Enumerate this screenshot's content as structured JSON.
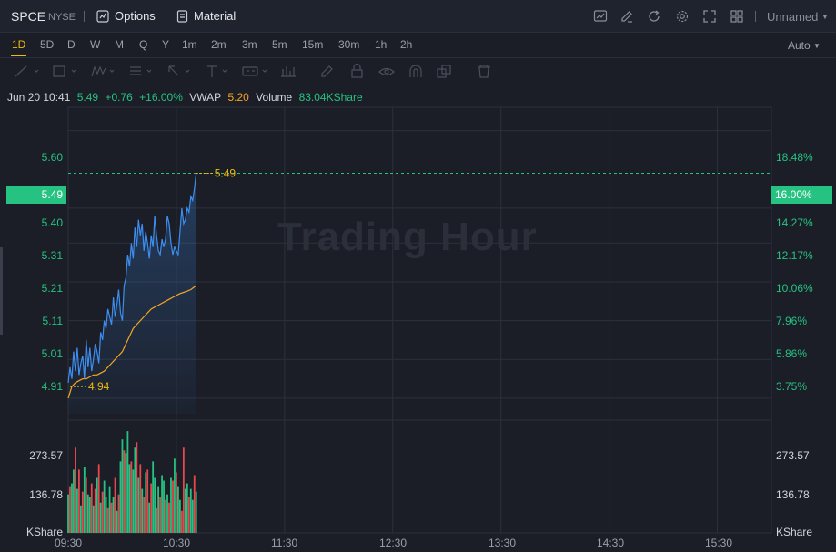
{
  "header": {
    "symbol": "SPCE",
    "exchange": "NYSE",
    "options_label": "Options",
    "material_label": "Material",
    "layout_name": "Unnamed"
  },
  "intervals": {
    "items": [
      "1D",
      "5D",
      "D",
      "W",
      "M",
      "Q",
      "Y",
      "1m",
      "2m",
      "3m",
      "5m",
      "15m",
      "30m",
      "1h",
      "2h"
    ],
    "active": "1D",
    "scale_label": "Auto"
  },
  "info": {
    "datetime": "Jun 20 10:41",
    "price": "5.49",
    "change": "+0.76",
    "change_pct": "+16.00%",
    "vwap_label": "VWAP",
    "vwap_value": "5.20",
    "volume_label": "Volume",
    "volume_value": "83.04KShare"
  },
  "price_axis": {
    "left_ticks": [
      "5.60",
      "5.40",
      "5.31",
      "5.21",
      "5.11",
      "5.01",
      "4.91"
    ],
    "right_ticks": [
      "18.48%",
      "14.27%",
      "12.17%",
      "10.06%",
      "7.96%",
      "5.86%",
      "3.75%"
    ],
    "current_left": "5.49",
    "current_right": "16.00%"
  },
  "volume_axis": {
    "ticks": [
      "273.57",
      "136.78"
    ],
    "unit": "KShare"
  },
  "time_axis": [
    "09:30",
    "10:30",
    "11:30",
    "12:30",
    "13:30",
    "14:30",
    "15:30"
  ],
  "watermark": "Trading Hour",
  "annotations": {
    "high_label": "5.49",
    "low_label": "4.94"
  },
  "colors": {
    "up": "#26c281",
    "down": "#e5484d",
    "price_line": "#3d8ef0",
    "vwap_line": "#f5a623",
    "accent": "#f0b90b"
  },
  "chart_data": {
    "type": "line",
    "x_range": [
      "09:30",
      "16:00"
    ],
    "ylim": [
      4.87,
      5.66
    ],
    "series": [
      {
        "name": "Price",
        "x": [
          "09:30",
          "09:31",
          "09:32",
          "09:33",
          "09:34",
          "09:35",
          "09:36",
          "09:37",
          "09:38",
          "09:39",
          "09:40",
          "09:41",
          "09:42",
          "09:43",
          "09:44",
          "09:45",
          "09:46",
          "09:47",
          "09:48",
          "09:49",
          "09:50",
          "09:51",
          "09:52",
          "09:53",
          "09:54",
          "09:55",
          "09:56",
          "09:57",
          "09:58",
          "09:59",
          "10:00",
          "10:01",
          "10:02",
          "10:03",
          "10:04",
          "10:05",
          "10:06",
          "10:07",
          "10:08",
          "10:09",
          "10:10",
          "10:11",
          "10:12",
          "10:13",
          "10:14",
          "10:15",
          "10:16",
          "10:17",
          "10:18",
          "10:19",
          "10:20",
          "10:21",
          "10:22",
          "10:23",
          "10:24",
          "10:25",
          "10:26",
          "10:27",
          "10:28",
          "10:29",
          "10:30",
          "10:31",
          "10:32",
          "10:33",
          "10:34",
          "10:35",
          "10:36",
          "10:37",
          "10:38",
          "10:39",
          "10:40",
          "10:41"
        ],
        "values": [
          4.95,
          4.99,
          4.96,
          5.03,
          4.98,
          5.04,
          4.97,
          5.0,
          5.02,
          4.96,
          5.06,
          4.99,
          5.04,
          4.98,
          5.01,
          5.05,
          5.03,
          5.0,
          5.08,
          5.06,
          5.11,
          5.09,
          5.14,
          5.12,
          5.1,
          5.17,
          5.12,
          5.15,
          5.19,
          5.13,
          5.11,
          5.2,
          5.22,
          5.28,
          5.25,
          5.31,
          5.27,
          5.35,
          5.3,
          5.37,
          5.33,
          5.36,
          5.29,
          5.34,
          5.31,
          5.27,
          5.33,
          5.3,
          5.38,
          5.33,
          5.29,
          5.28,
          5.32,
          5.3,
          5.32,
          5.38,
          5.36,
          5.31,
          5.28,
          5.3,
          5.29,
          5.28,
          5.34,
          5.4,
          5.36,
          5.37,
          5.4,
          5.39,
          5.43,
          5.42,
          5.45,
          5.49
        ]
      },
      {
        "name": "VWAP",
        "x": [
          "09:30",
          "09:32",
          "09:34",
          "09:36",
          "09:38",
          "09:40",
          "09:42",
          "09:44",
          "09:46",
          "09:48",
          "09:50",
          "09:52",
          "09:54",
          "09:56",
          "09:58",
          "10:00",
          "10:02",
          "10:04",
          "10:06",
          "10:08",
          "10:10",
          "10:12",
          "10:14",
          "10:16",
          "10:18",
          "10:20",
          "10:22",
          "10:24",
          "10:26",
          "10:28",
          "10:30",
          "10:32",
          "10:34",
          "10:36",
          "10:38",
          "10:40",
          "10:41"
        ],
        "values": [
          4.91,
          4.94,
          4.95,
          4.955,
          4.96,
          4.96,
          4.965,
          4.97,
          4.97,
          4.975,
          4.98,
          4.99,
          5.0,
          5.01,
          5.02,
          5.03,
          5.05,
          5.07,
          5.09,
          5.1,
          5.11,
          5.12,
          5.13,
          5.14,
          5.145,
          5.15,
          5.155,
          5.16,
          5.165,
          5.17,
          5.175,
          5.18,
          5.183,
          5.186,
          5.19,
          5.197,
          5.2
        ]
      }
    ],
    "volume": {
      "unit": "KShare",
      "ylim": [
        0,
        410
      ],
      "values": [
        140,
        170,
        180,
        230,
        310,
        160,
        230,
        100,
        150,
        240,
        200,
        140,
        130,
        180,
        100,
        160,
        200,
        250,
        110,
        150,
        190,
        130,
        90,
        170,
        110,
        130,
        200,
        80,
        140,
        260,
        340,
        300,
        290,
        370,
        250,
        260,
        230,
        310,
        330,
        200,
        250,
        160,
        130,
        220,
        230,
        110,
        180,
        260,
        200,
        90,
        170,
        130,
        210,
        190,
        120,
        140,
        110,
        200,
        190,
        270,
        220,
        170,
        120,
        80,
        310,
        160,
        180,
        130,
        160,
        120,
        210,
        150
      ],
      "up": [
        true,
        false,
        true,
        true,
        false,
        true,
        false,
        true,
        false,
        true,
        false,
        true,
        true,
        false,
        true,
        false,
        true,
        false,
        true,
        false,
        true,
        true,
        false,
        true,
        false,
        true,
        false,
        true,
        false,
        true,
        true,
        false,
        true,
        true,
        true,
        false,
        true,
        true,
        false,
        true,
        false,
        true,
        false,
        true,
        false,
        true,
        false,
        true,
        true,
        false,
        true,
        false,
        true,
        true,
        false,
        true,
        false,
        true,
        false,
        true,
        false,
        true,
        true,
        false,
        false,
        true,
        true,
        false,
        true,
        true,
        false,
        true
      ]
    }
  }
}
